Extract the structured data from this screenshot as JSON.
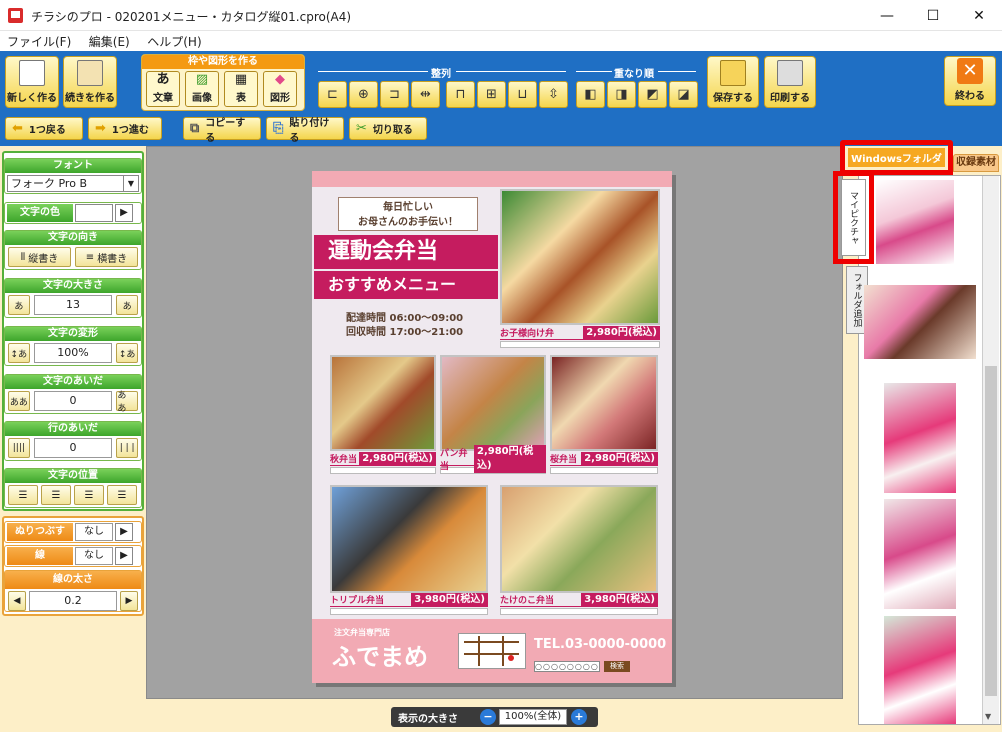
{
  "window": {
    "title": "チラシのプロ - 020201メニュー・カタログ縦01.cpro(A4)",
    "minimize": "—",
    "maximize": "☐",
    "close": "✕"
  },
  "menu": [
    "ファイル(F)",
    "編集(E)",
    "ヘルプ(H)"
  ],
  "toolbar": {
    "new_label": "新しく作る",
    "continue_label": "続きを作る",
    "shapes_group_title": "枠や図形を作る",
    "shapes": [
      {
        "label": "文章",
        "glyph": "あ"
      },
      {
        "label": "画像",
        "glyph": "▨"
      },
      {
        "label": "表",
        "glyph": "▦"
      },
      {
        "label": "図形",
        "glyph": "◆"
      }
    ],
    "align_title": "整列",
    "order_title": "重なり順",
    "save_label": "保存する",
    "print_label": "印刷する",
    "end_label": "終わる",
    "back_label": "1つ戻る",
    "forward_label": "1つ進む",
    "copy_label": "コピーする",
    "paste_label": "貼り付ける",
    "cut_label": "切り取る"
  },
  "left": {
    "font_title": "フォント",
    "font_value": "フォーク Pro B",
    "color_title": "文字の色",
    "direction_title": "文字の向き",
    "vertical_label": "縦書き",
    "horizontal_label": "横書き",
    "size_title": "文字の大きさ",
    "size_value": "13",
    "transform_title": "文字の変形",
    "transform_value": "100%",
    "spacing_title": "文字のあいだ",
    "spacing_value": "0",
    "line_title": "行のあいだ",
    "line_value": "0",
    "position_title": "文字の位置",
    "fill_title": "ぬりつぶす",
    "fill_value": "なし",
    "border_title": "線",
    "border_value": "なし",
    "width_title": "線の太さ",
    "width_value": "0.2"
  },
  "zoom": {
    "label": "表示の大きさ",
    "value": "100%(全体)"
  },
  "right": {
    "tab_windows": "Windowsフォルダ",
    "tab_builtin": "収録素材",
    "vtab_pictures": "マイピクチャ",
    "vtab_add": "フォルダ追加"
  },
  "flyer": {
    "tag1": "毎日忙しい",
    "tag2": "お母さんのお手伝い！",
    "headline": "運動会弁当",
    "subheadline": "おすすめメニュー",
    "delivery": "配達時間 06:00～09:00",
    "pickup": "回収時間 17:00～21:00",
    "items": [
      {
        "name": "お子様向け弁",
        "price": "2,980円(税込)"
      },
      {
        "name": "秋弁当",
        "price": "2,980円(税込)"
      },
      {
        "name": "パン弁当",
        "price": "2,980円(税込)"
      },
      {
        "name": "桜弁当",
        "price": "2,980円(税込)"
      },
      {
        "name": "トリプル弁当",
        "price": "3,980円(税込)"
      },
      {
        "name": "たけのこ弁当",
        "price": "3,980円(税込)"
      }
    ],
    "shop_label": "注文弁当専門店",
    "shop_name": "ふでまめ",
    "tel": "TEL.03-0000-0000",
    "map_btn": "検索"
  }
}
